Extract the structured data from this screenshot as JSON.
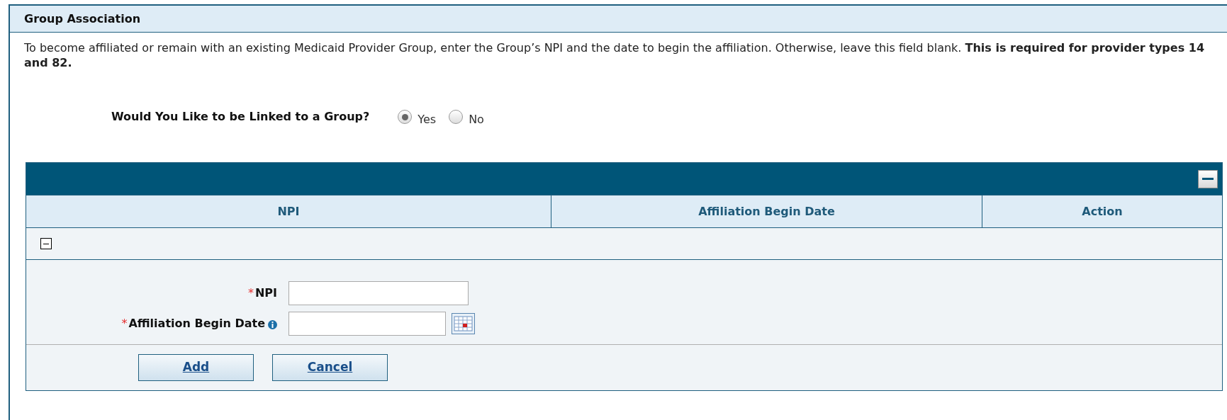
{
  "section": {
    "title": "Group Association",
    "description": "To become affiliated or remain with an existing Medicaid Provider Group, enter the Group’s NPI and the date to begin the affiliation. Otherwise, leave this field blank. **This is required for provider types 14 and 82.**"
  },
  "link_question": {
    "label": "Would You Like to be Linked to a Group?",
    "options": [
      {
        "label": "Yes",
        "selected": true
      },
      {
        "label": "No",
        "selected": false
      }
    ]
  },
  "table": {
    "columns": [
      "NPI",
      "Affiliation Begin Date",
      "Action"
    ]
  },
  "form": {
    "fields": [
      {
        "marker": "*",
        "label": "NPI",
        "kind": "text"
      },
      {
        "marker": "*",
        "label": "Affiliation Begin Date",
        "kind": "date"
      }
    ],
    "buttons": [
      "Add",
      "Cancel"
    ]
  }
}
